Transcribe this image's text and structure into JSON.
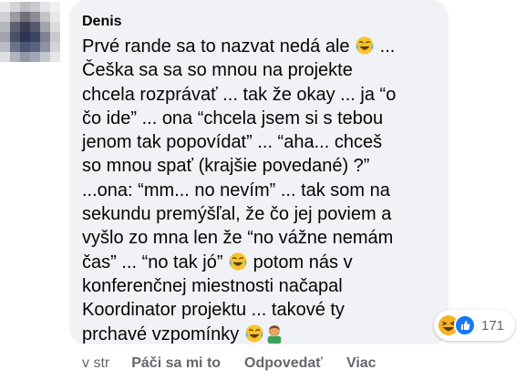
{
  "comment": {
    "author": "Denis",
    "lines": [
      {
        "text": "Prvé rande sa to nazvat nedá ale ",
        "emoji": "laughing-crying-face",
        "after": " ..."
      },
      {
        "text": "Češka sa sa so mnou na projekte"
      },
      {
        "text": "chcela rozprávať ... tak že okay ... ja “o"
      },
      {
        "text": "čo ide” ... ona “chcela jsem si s tebou"
      },
      {
        "text": "jenom tak popovídat” ... “aha... chceš"
      },
      {
        "text": "so mnou spať (krajšie povedané) ?”"
      },
      {
        "text": "...ona: “mm... no nevím” ... tak som na"
      },
      {
        "text": "sekundu premýšľal, že čo jej poviem a"
      },
      {
        "text": "vyšlo zo mna len že “no vážne nemám"
      },
      {
        "text": "čas” ... “no tak jó” ",
        "emoji": "laughing-crying-face",
        "after": " potom nás v"
      },
      {
        "text": "konferenčnej miestnosti načapal"
      },
      {
        "text": "Koordinator projektu ... takové ty"
      },
      {
        "text": "prchavé vzpomínky ",
        "emoji": "laughing-crying-face",
        "emoji2": "man-facepalming"
      }
    ]
  },
  "reactions": {
    "icons": [
      "laughing-reaction",
      "like-reaction"
    ],
    "count": "171"
  },
  "actions": {
    "time": "v str",
    "like": "Páči sa mi to",
    "reply": "Odpovedať",
    "more": "Viac"
  },
  "colors": {
    "bubble": "#f0f2f5",
    "text": "#050505",
    "secondary": "#65676b",
    "like_blue": "#1877f2",
    "emoji_yellow": "#f7b125"
  }
}
